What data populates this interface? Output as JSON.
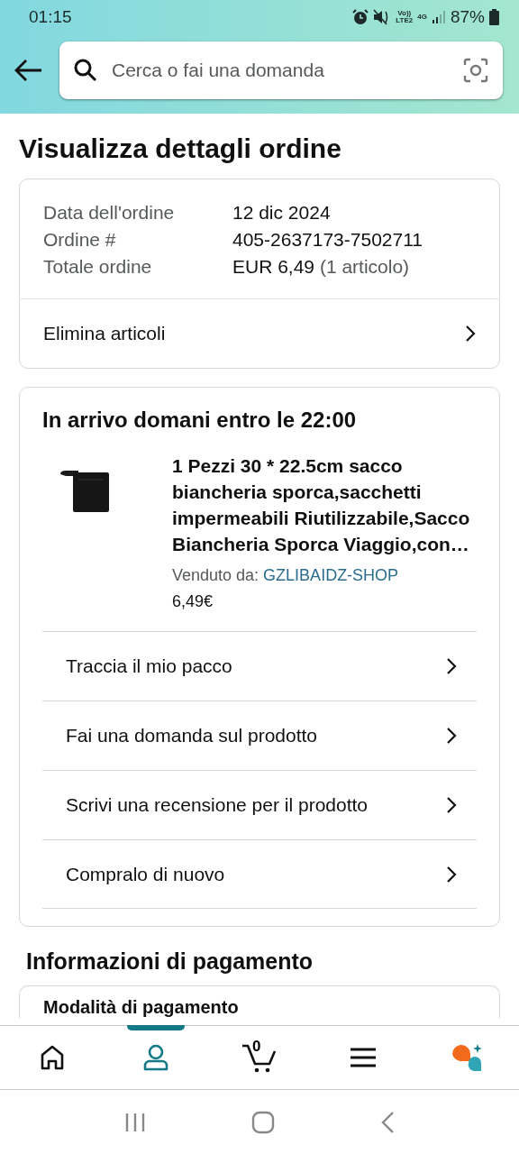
{
  "status_bar": {
    "time": "01:15",
    "volte": "Vo))",
    "lte": "LTE2",
    "network": "4G",
    "battery": "87%"
  },
  "search": {
    "placeholder": "Cerca o fai una domanda"
  },
  "title": "Visualizza dettagli ordine",
  "summary": {
    "rows": [
      {
        "label": "Data dell'ordine",
        "value": "12 dic 2024"
      },
      {
        "label": "Ordine #",
        "value": "405-2637173-7502711"
      },
      {
        "label": "Totale ordine",
        "value": "EUR 6,49",
        "note": "(1 articolo)"
      }
    ],
    "action": "Elimina articoli"
  },
  "shipment": {
    "heading": "In arrivo domani entro le 22:00",
    "product": {
      "kind": "picture",
      "title": "1 Pezzi 30 * 22.5cm sacco biancheria sporca,sacchetti impermeabili Riutilizzabile,Sacco Biancheria Sporca Viaggio,con…",
      "seller_label": "Venduto da:",
      "seller": "GZLIBAIDZ-SHOP",
      "price": "6,49€"
    },
    "actions": [
      "Traccia il mio pacco",
      "Fai una domanda sul prodotto",
      "Scrivi una recensione per il prodotto",
      "Compralo di nuovo"
    ]
  },
  "payment": {
    "heading": "Informazioni di pagamento",
    "card_title": "Modalità di pagamento"
  },
  "nav": [
    {
      "kind": "home",
      "selected": false
    },
    {
      "kind": "account",
      "selected": true
    },
    {
      "kind": "cart",
      "count": "0",
      "selected": false
    },
    {
      "kind": "menu",
      "selected": false
    },
    {
      "kind": "assistant",
      "selected": false
    }
  ]
}
